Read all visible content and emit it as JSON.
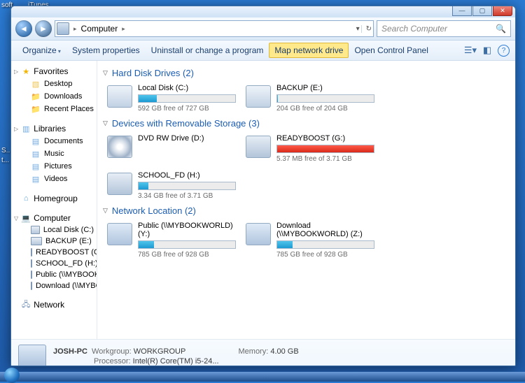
{
  "hidden_apps": [
    "soft",
    "iTunes"
  ],
  "desktop_icons": [
    "S...",
    "t..."
  ],
  "address": {
    "root": "Computer",
    "search_placeholder": "Search Computer"
  },
  "toolbar": {
    "organize": "Organize",
    "sys_props": "System properties",
    "uninstall": "Uninstall or change a program",
    "map_drive": "Map network drive",
    "control_panel": "Open Control Panel"
  },
  "nav": {
    "favorites": {
      "label": "Favorites",
      "items": [
        "Desktop",
        "Downloads",
        "Recent Places"
      ]
    },
    "libraries": {
      "label": "Libraries",
      "items": [
        "Documents",
        "Music",
        "Pictures",
        "Videos"
      ]
    },
    "homegroup": {
      "label": "Homegroup"
    },
    "computer": {
      "label": "Computer",
      "items": [
        "Local Disk (C:)",
        "BACKUP (E:)",
        "READYBOOST (G:)",
        "SCHOOL_FD (H:)",
        "Public (\\\\MYBOOKW",
        "Download (\\\\MYBO"
      ]
    },
    "network": {
      "label": "Network"
    }
  },
  "groups": {
    "hdd_label": "Hard Disk Drives (2)",
    "rem_label": "Devices with Removable Storage (3)",
    "net_label": "Network Location (2)"
  },
  "drives": {
    "hdd": [
      {
        "name": "Local Disk (C:)",
        "free": "592 GB free of 727 GB",
        "pct": 19
      },
      {
        "name": "BACKUP (E:)",
        "free": "204 GB free of 204 GB",
        "pct": 1
      }
    ],
    "rem": [
      {
        "name": "DVD RW Drive (D:)",
        "free": "",
        "pct": -1,
        "icon": "dvd"
      },
      {
        "name": "READYBOOST (G:)",
        "free": "5.37 MB free of 3.71 GB",
        "pct": 100,
        "icon": "usb"
      },
      {
        "name": "SCHOOL_FD (H:)",
        "free": "3.34 GB free of 3.71 GB",
        "pct": 10,
        "icon": "usb"
      }
    ],
    "net": [
      {
        "name": "Public (\\\\MYBOOKWORLD) (Y:)",
        "free": "785 GB free of 928 GB",
        "pct": 16
      },
      {
        "name": "Download (\\\\MYBOOKWORLD) (Z:)",
        "free": "785 GB free of 928 GB",
        "pct": 16
      }
    ]
  },
  "details": {
    "name": "JOSH-PC",
    "workgroup_lbl": "Workgroup:",
    "workgroup": "WORKGROUP",
    "memory_lbl": "Memory:",
    "memory": "4.00 GB",
    "processor_lbl": "Processor:",
    "processor": "Intel(R) Core(TM) i5-24..."
  }
}
